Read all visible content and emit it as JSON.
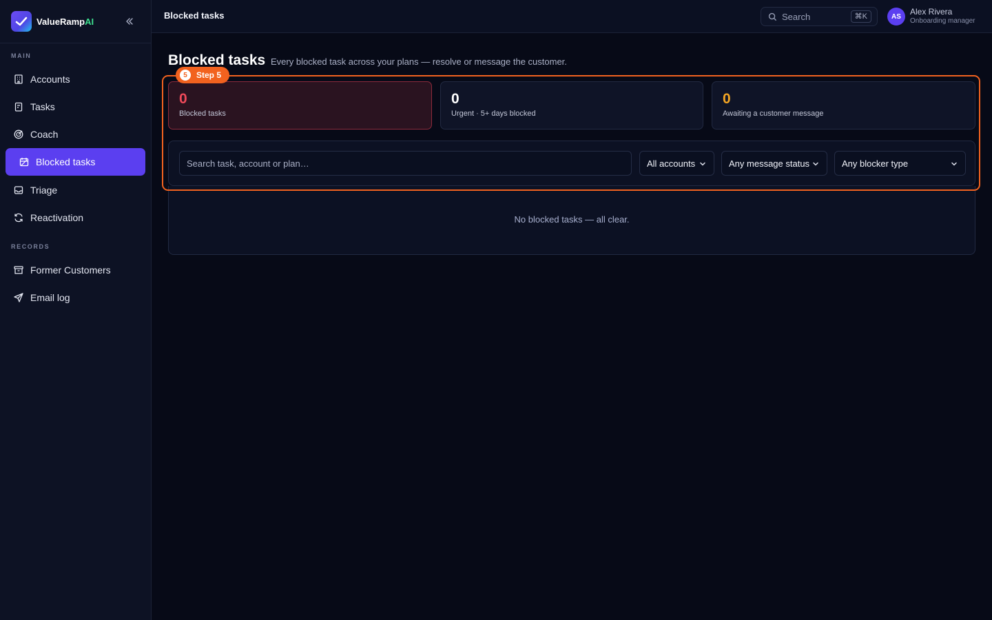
{
  "brand": {
    "name": "ValueRamp",
    "suffix": "AI"
  },
  "sidebar": {
    "sections": [
      {
        "label": "MAIN"
      },
      {
        "label": "RECORDS"
      }
    ],
    "items": [
      {
        "label": "Accounts",
        "icon": "building-icon"
      },
      {
        "label": "Tasks",
        "icon": "clipboard-icon"
      },
      {
        "label": "Coach",
        "icon": "target-icon"
      },
      {
        "label": "Blocked tasks",
        "icon": "blocked-calendar-icon",
        "active": true
      },
      {
        "label": "Triage",
        "icon": "inbox-icon"
      },
      {
        "label": "Reactivation",
        "icon": "refresh-icon"
      },
      {
        "label": "Former Customers",
        "icon": "archive-icon"
      },
      {
        "label": "Email log",
        "icon": "send-icon"
      }
    ]
  },
  "header": {
    "breadcrumb": "Blocked tasks",
    "search_label": "Search",
    "shortcut": "⌘K",
    "user": {
      "initials": "AS",
      "name": "Alex Rivera",
      "role": "Onboarding manager"
    }
  },
  "main": {
    "title": "Blocked tasks",
    "subtitle": "Every blocked task across your plans — resolve or message the customer.",
    "step": {
      "number": "5",
      "label": "Step 5"
    },
    "stats": [
      {
        "value": "0",
        "label": "Blocked tasks",
        "color": "#f04a5a"
      },
      {
        "value": "0",
        "label": "Urgent · 5+ days blocked",
        "color": "#ffffff"
      },
      {
        "value": "0",
        "label": "Awaiting a customer message",
        "color": "#f5a623"
      }
    ],
    "filters": {
      "search_placeholder": "Search task, account or plan…",
      "accounts": "All accounts",
      "message_status": "Any message status",
      "blocker_type": "Any blocker type"
    },
    "empty_message": "No blocked tasks — all clear."
  },
  "colors": {
    "accent": "#5b3ff0",
    "highlight": "#f2621f",
    "brand_ai": "#3ee08f"
  }
}
